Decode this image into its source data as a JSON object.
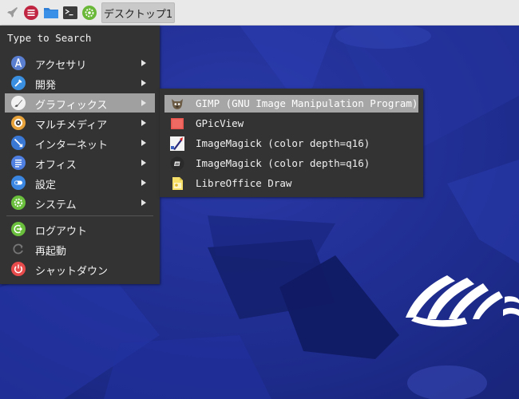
{
  "panel": {
    "launcher_icon": "rocket-icon",
    "menu_icon": "hamburger-menu-icon",
    "files_icon": "folder-icon",
    "terminal_icon": "terminal-icon",
    "settings_icon": "gear-icon",
    "workspace_label": "デスクトップ1"
  },
  "menu": {
    "search_placeholder": "Type to Search",
    "categories": [
      {
        "label": "アクセサリ",
        "icon": "accessories-icon",
        "color": "#5a7fd1"
      },
      {
        "label": "開発",
        "icon": "development-icon",
        "color": "#3b8fe0"
      },
      {
        "label": "グラフィックス",
        "icon": "graphics-icon",
        "color": "#f0f0f0"
      },
      {
        "label": "マルチメディア",
        "icon": "multimedia-icon",
        "color": "#e8a23a"
      },
      {
        "label": "インターネット",
        "icon": "internet-icon",
        "color": "#3a78d6"
      },
      {
        "label": "オフィス",
        "icon": "office-icon",
        "color": "#4f7fe0"
      },
      {
        "label": "設定",
        "icon": "settings-icon",
        "color": "#3a86e0"
      },
      {
        "label": "システム",
        "icon": "system-icon",
        "color": "#6abf3c"
      }
    ],
    "session": [
      {
        "label": "ログアウト",
        "icon": "logout-icon",
        "color": "#6abf3c"
      },
      {
        "label": "再起動",
        "icon": "restart-icon",
        "color": "#777777"
      },
      {
        "label": "シャットダウン",
        "icon": "shutdown-icon",
        "color": "#e84b4b"
      }
    ]
  },
  "submenu": {
    "items": [
      {
        "label": "GIMP (GNU Image Manipulation Program)",
        "icon": "gimp-icon"
      },
      {
        "label": "GPicView",
        "icon": "gpicview-icon"
      },
      {
        "label": "ImageMagick (color depth=q16)",
        "icon": "imagemagick-icon"
      },
      {
        "label": "ImageMagick (color depth=q16)",
        "icon": "imagemagick-display-icon"
      },
      {
        "label": "LibreOffice Draw",
        "icon": "libreoffice-draw-icon"
      }
    ]
  },
  "colors": {
    "panel_bg": "#e9e9e9",
    "menu_bg": "#333333",
    "highlight": "#a0a0a0",
    "wallpaper": "#1c2a86"
  }
}
